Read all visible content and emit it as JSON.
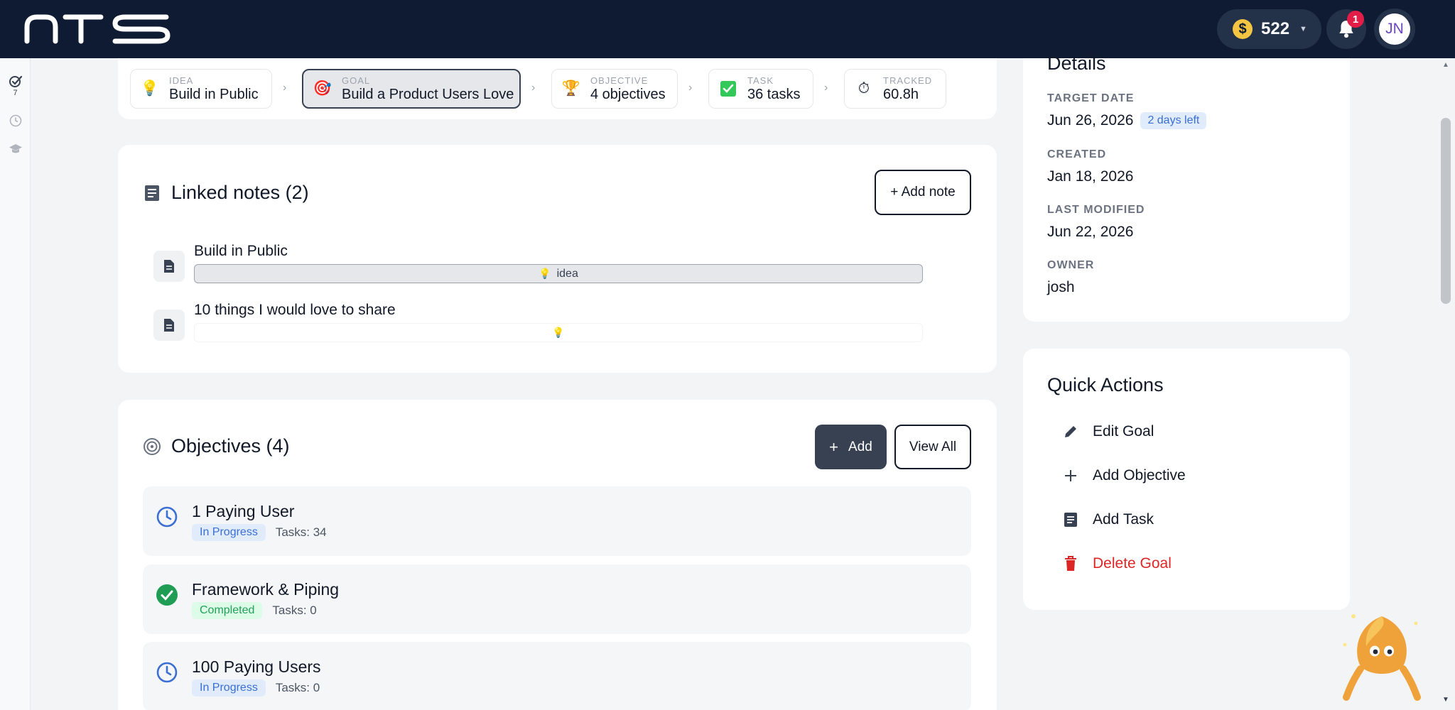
{
  "topbar": {
    "logo_text": "NTS",
    "coins": "522",
    "notifications_count": "1",
    "user_initials": "JN"
  },
  "rail": {
    "goals_count": "7"
  },
  "breadcrumb": [
    {
      "kicker": "IDEA",
      "label": "Build in Public",
      "icon": "lightbulb-icon"
    },
    {
      "kicker": "GOAL",
      "label": "Build a Product Users Love",
      "icon": "target-icon"
    },
    {
      "kicker": "OBJECTIVE",
      "label": "4 objectives",
      "icon": "trophy-icon"
    },
    {
      "kicker": "TASK",
      "label": "36 tasks",
      "icon": "checkbox-icon"
    },
    {
      "kicker": "TRACKED",
      "label": "60.8h",
      "icon": "stopwatch-icon"
    }
  ],
  "notes": {
    "title": "Linked notes (2)",
    "add_label": "+ Add note",
    "items": [
      {
        "title": "Build in Public",
        "tag": "idea"
      },
      {
        "title": "10 things I would love to share",
        "tag": ""
      }
    ]
  },
  "objectives": {
    "title": "Objectives (4)",
    "add_label": "Add",
    "view_all_label": "View All",
    "items": [
      {
        "title": "1 Paying User",
        "status": "In Progress",
        "tasks": "Tasks: 34"
      },
      {
        "title": "Framework & Piping",
        "status": "Completed",
        "tasks": "Tasks: 0"
      },
      {
        "title": "100 Paying Users",
        "status": "In Progress",
        "tasks": "Tasks: 0"
      }
    ]
  },
  "details": {
    "title": "Details",
    "target_label": "TARGET DATE",
    "target_value": "Jun 26, 2026",
    "days_left": "2 days left",
    "created_label": "CREATED",
    "created_value": "Jan 18, 2026",
    "modified_label": "LAST MODIFIED",
    "modified_value": "Jun 22, 2026",
    "owner_label": "OWNER",
    "owner_value": "josh"
  },
  "quick_actions": {
    "title": "Quick Actions",
    "edit": "Edit Goal",
    "add_objective": "Add Objective",
    "add_task": "Add Task",
    "delete": "Delete Goal"
  },
  "colors": {
    "topbar": "#0f1b33",
    "danger": "#dc2626",
    "progress": "#3b6fd4",
    "completed": "#22a05a"
  }
}
